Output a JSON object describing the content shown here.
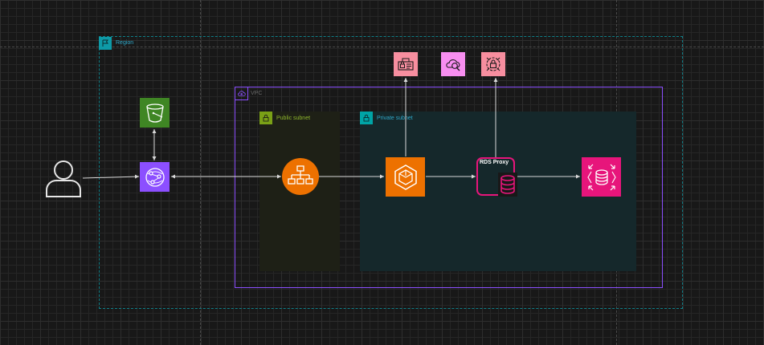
{
  "groups": {
    "region": {
      "label": "Region",
      "color": "#0e9aa7"
    },
    "vpc": {
      "label": "VPC",
      "color": "#8c4fff"
    },
    "public_subnet": {
      "label": "Public subnet",
      "color": "#7aa116"
    },
    "private_subnet": {
      "label": "Private subnet",
      "color": "#00a4a6"
    }
  },
  "nodes": {
    "user": {
      "icon": "user-icon"
    },
    "s3": {
      "icon": "s3-bucket-icon",
      "color": "#3f8624"
    },
    "cloudfront": {
      "icon": "cloudfront-icon",
      "color": "#8c4fff"
    },
    "alb": {
      "icon": "load-balancer-icon",
      "color": "#ed7100"
    },
    "ecs": {
      "icon": "ecs-icon",
      "color": "#ed7100"
    },
    "rds_proxy": {
      "label": "RDS Proxy",
      "icon": "rds-proxy-icon",
      "color": "#e7157b"
    },
    "rds": {
      "icon": "rds-database-icon",
      "color": "#e7157b"
    },
    "secrets_manager": {
      "icon": "secrets-manager-icon",
      "color": "#f78e9f"
    },
    "cloudwatch": {
      "icon": "cloudwatch-icon",
      "color": "#f78ef0"
    },
    "kms": {
      "icon": "kms-icon",
      "color": "#f78e9f"
    }
  }
}
